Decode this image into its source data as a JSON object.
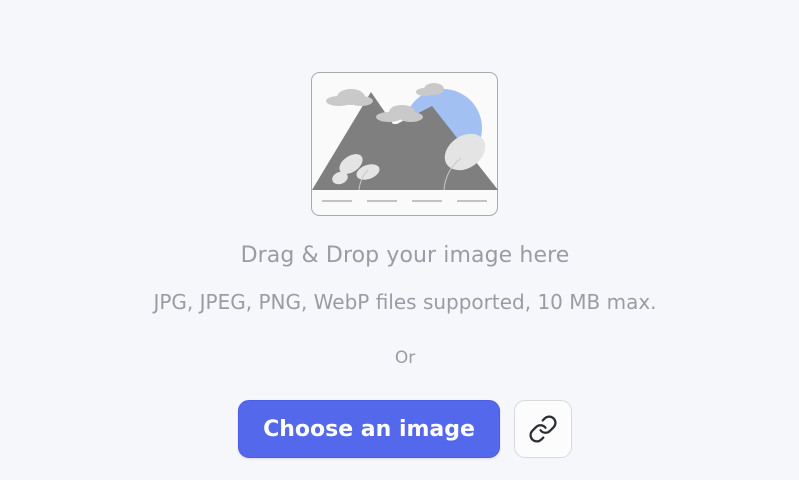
{
  "upload": {
    "title": "Drag & Drop your image here",
    "subtitle": "JPG, JPEG, PNG, WebP files supported, 10 MB max.",
    "or_label": "Or",
    "choose_button_label": "Choose an image"
  },
  "icons": {
    "illustration": "image-placeholder-illustration",
    "link": "link-icon"
  },
  "colors": {
    "background": "#f6f7fa",
    "primary_button": "#5468ec",
    "muted_text": "#9a9ca5",
    "illustration_sun": "#a3c0f2",
    "illustration_mountain": "#7f7f7f"
  }
}
